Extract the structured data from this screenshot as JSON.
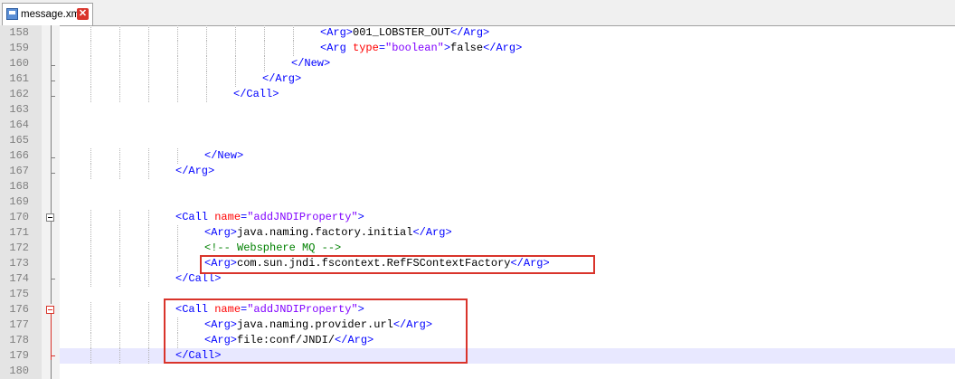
{
  "tab": {
    "title": "message.xml",
    "close_glyph": "✕"
  },
  "lines": [
    {
      "num": "158",
      "indent": 9,
      "tokens": [
        {
          "t": "<Arg>",
          "k": "t"
        },
        {
          "t": "001_LOBSTER_OUT",
          "k": "x"
        },
        {
          "t": "</Arg>",
          "k": "t"
        }
      ]
    },
    {
      "num": "159",
      "indent": 9,
      "tokens": [
        {
          "t": "<Arg ",
          "k": "t"
        },
        {
          "t": "type",
          "k": "a"
        },
        {
          "t": "=",
          "k": "t"
        },
        {
          "t": "\"boolean\"",
          "k": "v"
        },
        {
          "t": ">",
          "k": "t"
        },
        {
          "t": "false",
          "k": "x"
        },
        {
          "t": "</Arg>",
          "k": "t"
        }
      ]
    },
    {
      "num": "160",
      "indent": 8,
      "tokens": [
        {
          "t": "</New>",
          "k": "t"
        }
      ]
    },
    {
      "num": "161",
      "indent": 7,
      "tokens": [
        {
          "t": "</Arg>",
          "k": "t"
        }
      ]
    },
    {
      "num": "162",
      "indent": 6,
      "tokens": [
        {
          "t": "</Call>",
          "k": "t"
        }
      ]
    },
    {
      "num": "163",
      "indent": 0,
      "tokens": []
    },
    {
      "num": "164",
      "indent": 0,
      "tokens": []
    },
    {
      "num": "165",
      "indent": 0,
      "tokens": []
    },
    {
      "num": "166",
      "indent": 5,
      "tokens": [
        {
          "t": "</New>",
          "k": "t"
        }
      ]
    },
    {
      "num": "167",
      "indent": 4,
      "tokens": [
        {
          "t": "</Arg>",
          "k": "t"
        }
      ]
    },
    {
      "num": "168",
      "indent": 0,
      "tokens": []
    },
    {
      "num": "169",
      "indent": 0,
      "tokens": []
    },
    {
      "num": "170",
      "indent": 4,
      "tokens": [
        {
          "t": "<Call ",
          "k": "t"
        },
        {
          "t": "name",
          "k": "a"
        },
        {
          "t": "=",
          "k": "t"
        },
        {
          "t": "\"addJNDIProperty\"",
          "k": "v"
        },
        {
          "t": ">",
          "k": "t"
        }
      ]
    },
    {
      "num": "171",
      "indent": 5,
      "tokens": [
        {
          "t": "<Arg>",
          "k": "t"
        },
        {
          "t": "java.naming.factory.initial",
          "k": "x"
        },
        {
          "t": "</Arg>",
          "k": "t"
        }
      ]
    },
    {
      "num": "172",
      "indent": 5,
      "tokens": [
        {
          "t": "<!-- Websphere MQ -->",
          "k": "c"
        }
      ]
    },
    {
      "num": "173",
      "indent": 5,
      "tokens": [
        {
          "t": "<Arg>",
          "k": "t"
        },
        {
          "t": "com.sun.jndi.fscontext.RefFSContextFactory",
          "k": "x"
        },
        {
          "t": "</Arg>",
          "k": "t"
        }
      ]
    },
    {
      "num": "174",
      "indent": 4,
      "tokens": [
        {
          "t": "</Call>",
          "k": "t"
        }
      ]
    },
    {
      "num": "175",
      "indent": 0,
      "tokens": []
    },
    {
      "num": "176",
      "indent": 4,
      "tokens": [
        {
          "t": "<Call ",
          "k": "t"
        },
        {
          "t": "name",
          "k": "a"
        },
        {
          "t": "=",
          "k": "t"
        },
        {
          "t": "\"addJNDIProperty\"",
          "k": "v"
        },
        {
          "t": ">",
          "k": "t"
        }
      ]
    },
    {
      "num": "177",
      "indent": 5,
      "tokens": [
        {
          "t": "<Arg>",
          "k": "t"
        },
        {
          "t": "java.naming.provider.url",
          "k": "x"
        },
        {
          "t": "</Arg>",
          "k": "t"
        }
      ]
    },
    {
      "num": "178",
      "indent": 5,
      "tokens": [
        {
          "t": "<Arg>",
          "k": "t"
        },
        {
          "t": "file:conf/JNDI/",
          "k": "x"
        },
        {
          "t": "</Arg>",
          "k": "t"
        }
      ]
    },
    {
      "num": "179",
      "indent": 4,
      "tokens": [
        {
          "t": "</Call>",
          "k": "t"
        }
      ],
      "current": true
    },
    {
      "num": "180",
      "indent": 0,
      "tokens": []
    }
  ],
  "colors": {
    "tag": "#0000ff",
    "attribute": "#ff0000",
    "attribute_value": "#8000ff",
    "comment": "#008000",
    "text": "#000000",
    "highlight_box": "#d9342b",
    "current_line": "#e8e8ff"
  }
}
